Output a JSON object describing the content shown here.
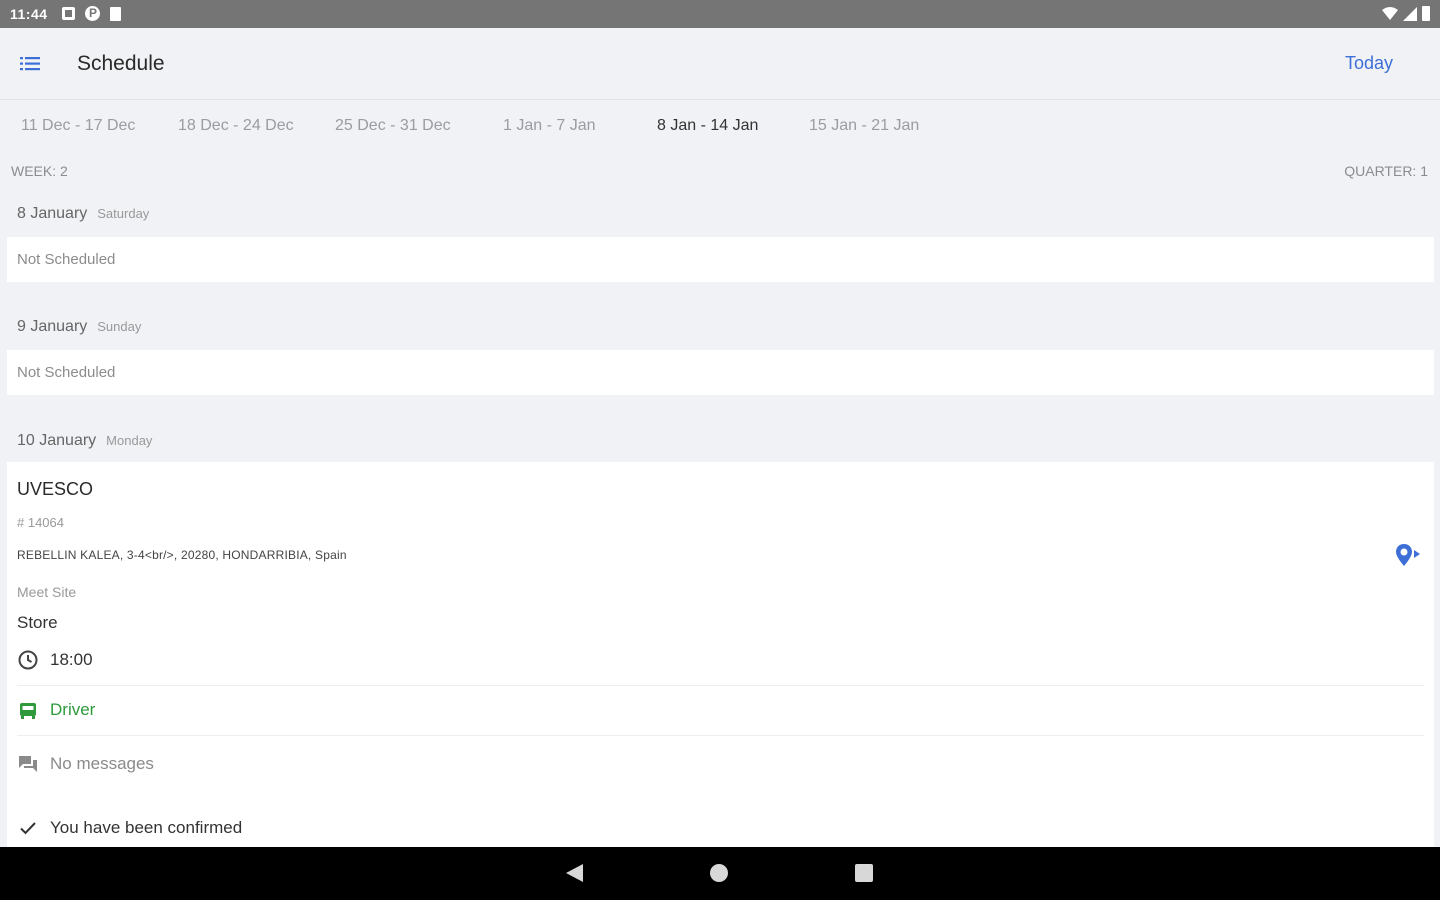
{
  "status_bar": {
    "time": "11:44"
  },
  "app_bar": {
    "title": "Schedule",
    "today_label": "Today"
  },
  "week_tabs": [
    {
      "label": "11 Dec - 17 Dec",
      "active": false
    },
    {
      "label": "18 Dec - 24 Dec",
      "active": false
    },
    {
      "label": "25 Dec - 31 Dec",
      "active": false
    },
    {
      "label": "1 Jan - 7 Jan",
      "active": false
    },
    {
      "label": "8 Jan - 14 Jan",
      "active": true
    },
    {
      "label": "15 Jan - 21 Jan",
      "active": false
    }
  ],
  "week_label": "WEEK: 2",
  "quarter_label": "QUARTER: 1",
  "days": [
    {
      "date": "8 January",
      "weekday": "Saturday",
      "status": "Not Scheduled"
    },
    {
      "date": "9 January",
      "weekday": "Sunday",
      "status": "Not Scheduled"
    },
    {
      "date": "10 January",
      "weekday": "Monday"
    }
  ],
  "job": {
    "site": "UVESCO",
    "number": "# 14064",
    "address": "REBELLIN KALEA, 3-4<br/>, 20280, HONDARRIBIA, Spain",
    "meet_label": "Meet Site",
    "meet_value": "Store",
    "time": "18:00",
    "role": "Driver",
    "messages": "No messages",
    "confirmation": "You have been confirmed"
  },
  "colors": {
    "accent": "#3d6fd6",
    "driver_green": "#2e9a3c",
    "background": "#f1f2f5",
    "status_bar": "#757575"
  },
  "icons": {
    "menu": "list-menu-icon",
    "map": "directions-pin-icon",
    "clock": "clock-icon",
    "driver": "bus-icon",
    "messages": "chat-bubbles-icon",
    "confirm": "checkmark-icon"
  }
}
